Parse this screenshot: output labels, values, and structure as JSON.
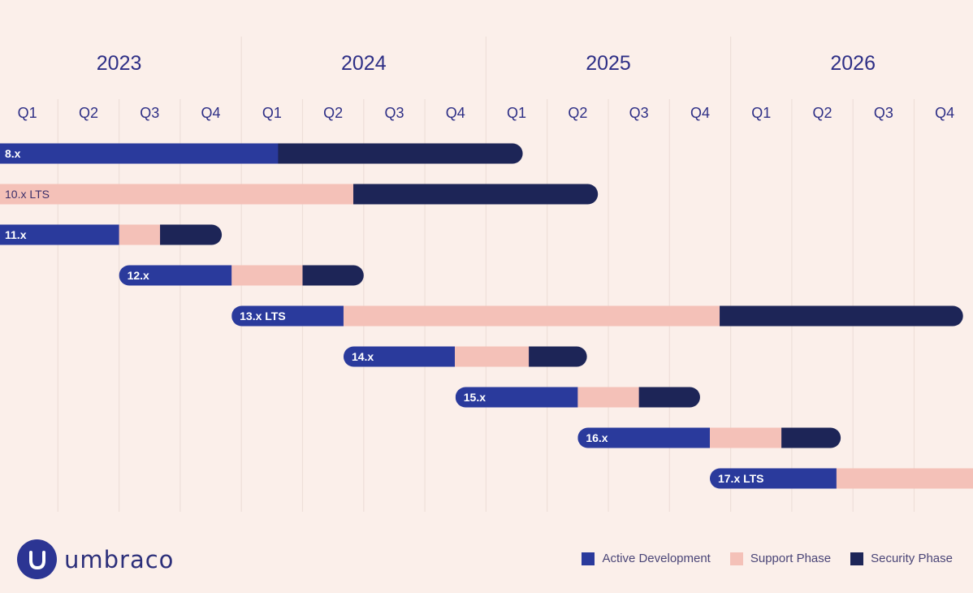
{
  "chart_data": {
    "type": "bar",
    "subtype": "gantt-timeline",
    "title": "",
    "xlabel": "",
    "ylabel": "",
    "x_unit": "quarters since start of 2023 (0 = start of Q1 2023)",
    "xlim": [
      0,
      16
    ],
    "grid": true,
    "years": [
      "2023",
      "2024",
      "2025",
      "2026"
    ],
    "quarters": [
      "Q1",
      "Q2",
      "Q3",
      "Q4"
    ],
    "phases": [
      {
        "key": "active",
        "name": "Active Development",
        "color": "#2a3a9c"
      },
      {
        "key": "support",
        "name": "Support Phase",
        "color": "#f4c1b8"
      },
      {
        "key": "security",
        "name": "Security Phase",
        "color": "#1d2557"
      }
    ],
    "legend_position": "bottom-right",
    "series": [
      {
        "name": "8.x",
        "start": -0.5,
        "segments": [
          {
            "phase": "active",
            "end": 4.6
          },
          {
            "phase": "security",
            "end": 8.6
          }
        ]
      },
      {
        "name": "10.x LTS",
        "start": -0.5,
        "segments": [
          {
            "phase": "support",
            "end": 5.83
          },
          {
            "phase": "security",
            "end": 9.83
          }
        ]
      },
      {
        "name": "11.x",
        "start": -0.5,
        "segments": [
          {
            "phase": "active",
            "end": 2.0
          },
          {
            "phase": "support",
            "end": 2.67
          },
          {
            "phase": "security",
            "end": 3.68
          }
        ]
      },
      {
        "name": "12.x",
        "start": 2.0,
        "segments": [
          {
            "phase": "active",
            "end": 3.84
          },
          {
            "phase": "support",
            "end": 5.0
          },
          {
            "phase": "security",
            "end": 6.0
          }
        ]
      },
      {
        "name": "13.x LTS",
        "start": 3.84,
        "segments": [
          {
            "phase": "active",
            "end": 5.67
          },
          {
            "phase": "support",
            "end": 11.82
          },
          {
            "phase": "security",
            "end": 15.8
          }
        ]
      },
      {
        "name": "14.x",
        "start": 5.67,
        "segments": [
          {
            "phase": "active",
            "end": 7.49
          },
          {
            "phase": "support",
            "end": 8.7
          },
          {
            "phase": "security",
            "end": 9.65
          }
        ]
      },
      {
        "name": "15.x",
        "start": 7.5,
        "segments": [
          {
            "phase": "active",
            "end": 9.5
          },
          {
            "phase": "support",
            "end": 10.5
          },
          {
            "phase": "security",
            "end": 11.5
          }
        ]
      },
      {
        "name": "16.x",
        "start": 9.5,
        "segments": [
          {
            "phase": "active",
            "end": 11.66
          },
          {
            "phase": "support",
            "end": 12.83
          },
          {
            "phase": "security",
            "end": 13.8
          }
        ]
      },
      {
        "name": "17.x LTS",
        "start": 11.66,
        "segments": [
          {
            "phase": "active",
            "end": 13.73
          },
          {
            "phase": "support",
            "end": 16.5
          }
        ]
      }
    ]
  },
  "logo": {
    "text": "umbraco"
  },
  "legend": {
    "items": [
      {
        "label": "Active Development",
        "color": "#2a3a9c"
      },
      {
        "label": "Support Phase",
        "color": "#f4c1b8"
      },
      {
        "label": "Security Phase",
        "color": "#1d2557"
      }
    ]
  }
}
